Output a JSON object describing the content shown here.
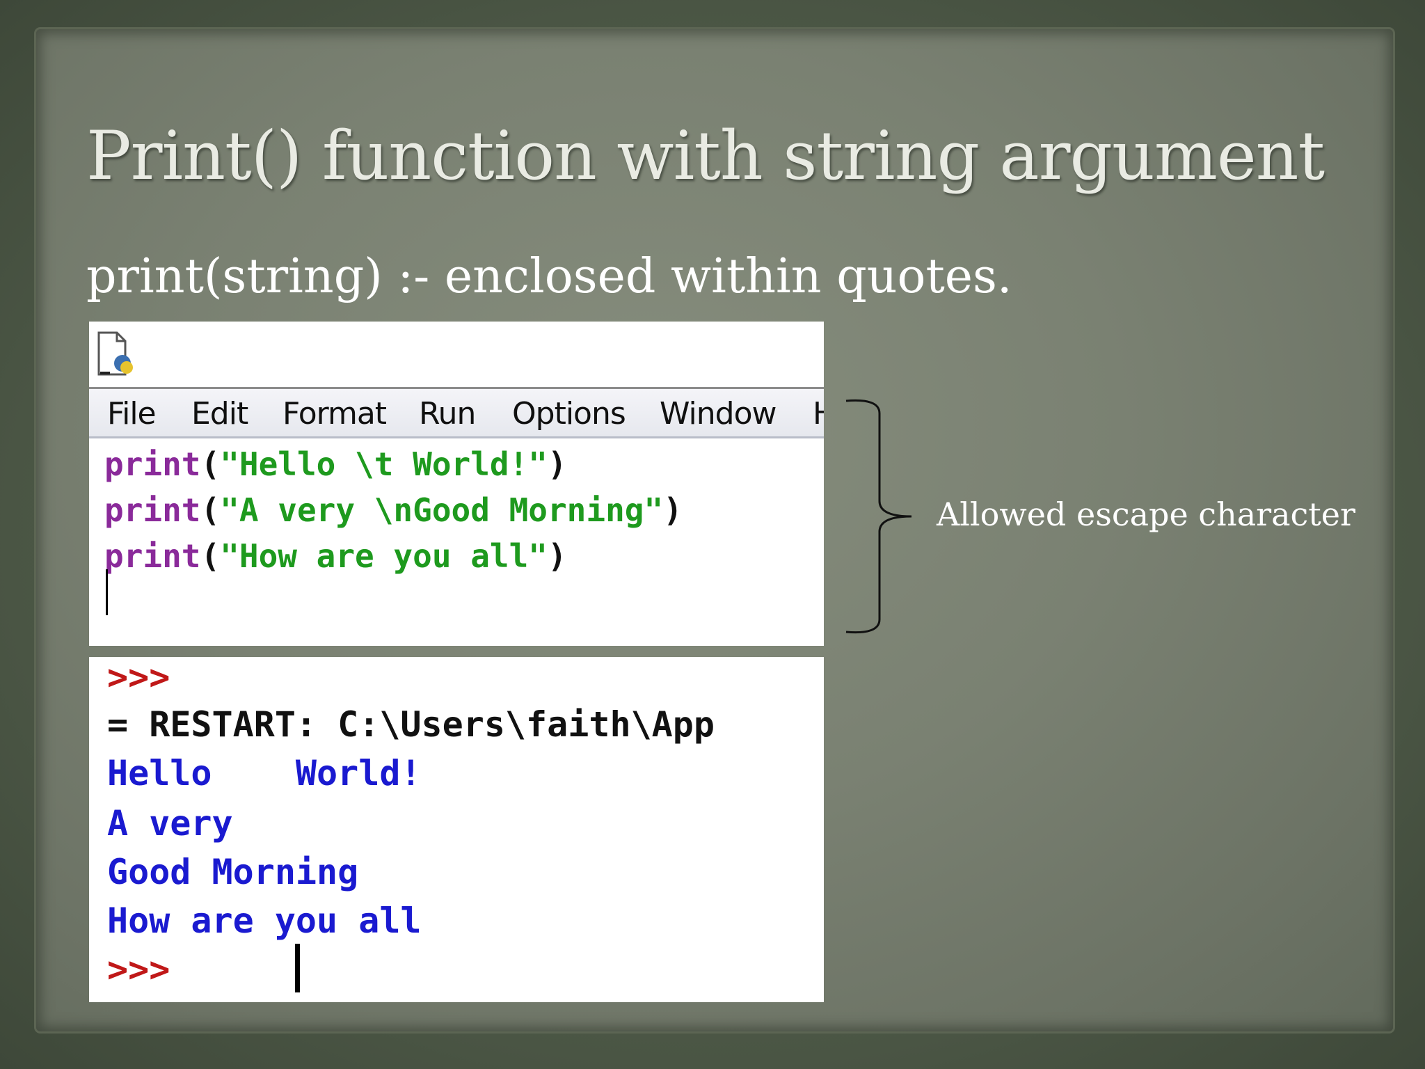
{
  "slide": {
    "title": "Print() function with string argument",
    "subtitle": "print(string) :- enclosed within quotes.",
    "annotation": "Allowed escape character"
  },
  "editor": {
    "icon": "idle-file-icon",
    "menu": [
      "File",
      "Edit",
      "Format",
      "Run",
      "Options",
      "Window",
      "H"
    ],
    "code": [
      {
        "fn": "print",
        "open": "(",
        "str": "\"Hello \\t World!\"",
        "close": ")"
      },
      {
        "fn": "print",
        "open": "(",
        "str": "\"A very \\nGood Morning\"",
        "close": ")"
      },
      {
        "fn": "print",
        "open": "(",
        "str": "\"How are you all\"",
        "close": ")"
      }
    ]
  },
  "shell": {
    "prompt_top": ">>>",
    "restart": "= RESTART: C:\\Users\\faith\\App",
    "output": [
      "Hello    World!",
      "A very",
      "Good Morning",
      "How are you all"
    ],
    "prompt_bottom": ">>>"
  },
  "colors": {
    "keyword": "#8a2a9a",
    "string": "#1e9a1e",
    "output": "#1a1ad0",
    "prompt": "#c01818"
  }
}
